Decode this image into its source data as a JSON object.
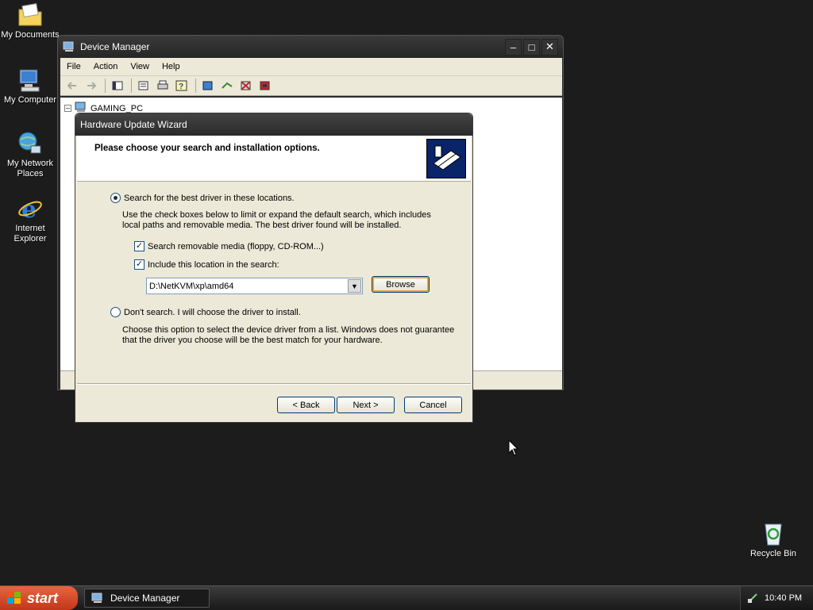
{
  "desktop": {
    "icons": [
      {
        "label": "My Documents",
        "icon": "folder-icon"
      },
      {
        "label": "My Computer",
        "icon": "computer-icon"
      },
      {
        "label": "My Network Places",
        "icon": "network-icon"
      },
      {
        "label": "Internet Explorer",
        "icon": "ie-icon"
      },
      {
        "label": "Recycle Bin",
        "icon": "recycle-bin-icon"
      }
    ]
  },
  "device_manager": {
    "title": "Device Manager",
    "menu": [
      "File",
      "Action",
      "View",
      "Help"
    ],
    "tree_root": "GAMING_PC"
  },
  "wizard": {
    "title": "Hardware Update Wizard",
    "header": "Please choose your search and installation options.",
    "option_search": {
      "label": "Search for the best driver in these locations.",
      "description": "Use the check boxes below to limit or expand the default search, which includes local paths and removable media. The best driver found will be installed.",
      "selected": true
    },
    "check_removable": {
      "label": "Search removable media (floppy, CD-ROM...)",
      "checked": true
    },
    "check_location": {
      "label": "Include this location in the search:",
      "checked": true
    },
    "location_value": "D:\\NetKVM\\xp\\amd64",
    "browse_label": "Browse",
    "option_manual": {
      "label": "Don't search. I will choose the driver to install.",
      "description": "Choose this option to select the device driver from a list.  Windows does not guarantee that the driver you choose will be the best match for your hardware.",
      "selected": false
    },
    "back_label": "< Back",
    "next_label": "Next >",
    "cancel_label": "Cancel"
  },
  "taskbar": {
    "start_label": "start",
    "task_label": "Device Manager",
    "clock": "10:40 PM"
  }
}
